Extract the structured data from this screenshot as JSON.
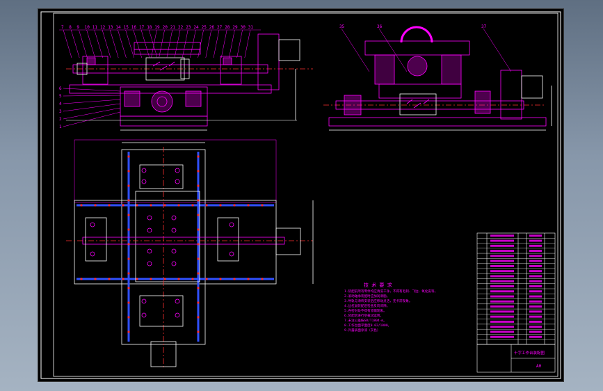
{
  "colors": {
    "background": "#000000",
    "border": "#ffffff",
    "part": "#ff00ff",
    "axis": "#ff3030",
    "rail": "#3050ff",
    "outline": "#ffffff"
  },
  "top_balloons": [
    "7",
    "8",
    "9",
    "10",
    "11",
    "12",
    "13",
    "14",
    "15",
    "16",
    "17",
    "18",
    "19",
    "20",
    "21",
    "22",
    "23",
    "24",
    "25",
    "26",
    "27",
    "28",
    "29",
    "30",
    "31"
  ],
  "left_balloons": [
    "6",
    "5",
    "4",
    "3",
    "2",
    "1"
  ],
  "right_balloons": [
    "35",
    "36",
    "37"
  ],
  "notes": {
    "title": "技 术 要 求",
    "lines": [
      "1.装配前所有零件均应清洗干净，不得有毛刺、飞边、氧化皮等。",
      "2.滚动轴承装配时应加润滑脂。",
      "3.导轨与滑块安装后应移动灵活，无卡滞现象。",
      "4.丝杠副装配后检查反向间隙。",
      "5.各密封处不得有渗漏现象。",
      "6.装配后进行空载试运转。",
      "7.未注公差按GB/T1804-m。",
      "8.工作台面平面度0.02/1000。",
      "9.外露表面涂漆（灰色）"
    ]
  },
  "bom": {
    "rows": 22,
    "title_block": "十字工作台装配图",
    "sheet": "A0"
  }
}
